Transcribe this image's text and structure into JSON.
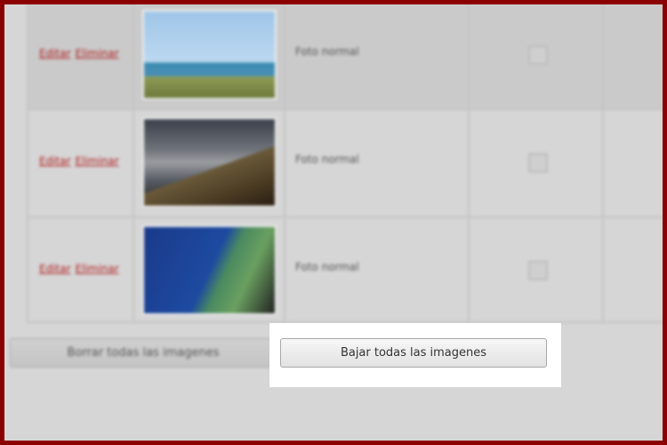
{
  "rows": [
    {
      "edit_label": "Editar",
      "delete_label": "Eliminar",
      "description": "Foto normal"
    },
    {
      "edit_label": "Editar",
      "delete_label": "Eliminar",
      "description": "Foto normal"
    },
    {
      "edit_label": "Editar",
      "delete_label": "Eliminar",
      "description": "Foto normal"
    }
  ],
  "buttons": {
    "delete_all": "Borrar todas las imagenes",
    "download_all": "Bajar todas las imagenes"
  },
  "colors": {
    "frame_border": "#8b0000",
    "link": "#b02020"
  }
}
